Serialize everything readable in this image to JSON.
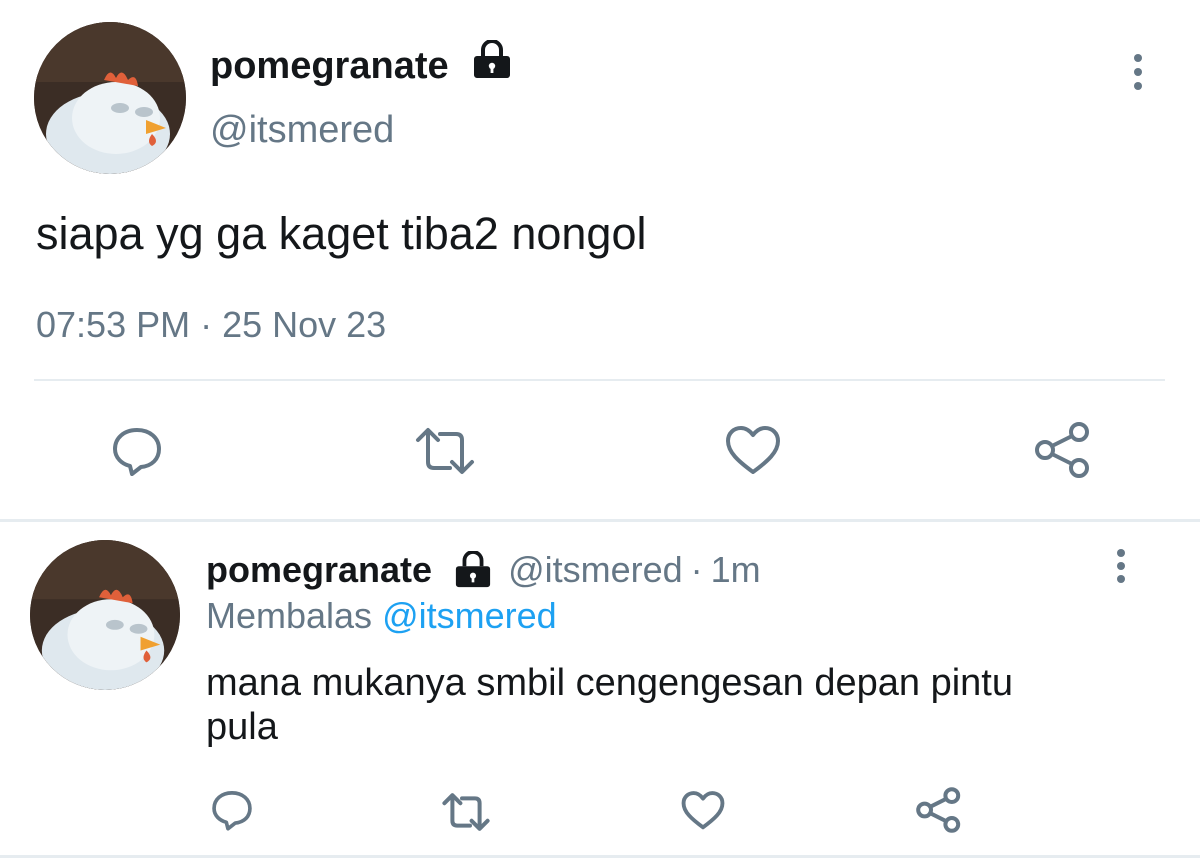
{
  "main_tweet": {
    "display_name": "pomegranate",
    "handle": "@itsmered",
    "text": "siapa yg ga kaget tiba2 nongol",
    "timestamp": "07:53 PM · 25 Nov 23",
    "actions": [
      "reply-icon",
      "retweet-icon",
      "like-icon",
      "share-icon"
    ]
  },
  "reply_tweet": {
    "display_name": "pomegranate",
    "handle": "@itsmered",
    "separator": "·",
    "age": "1m",
    "replying_prefix": "Membalas",
    "replying_to": "@itsmered",
    "text_line1": "mana mukanya smbil cengengesan depan pintu",
    "text_line2": "pula",
    "actions": [
      "reply-icon",
      "retweet-icon",
      "like-icon",
      "share-icon"
    ]
  },
  "colors": {
    "text": "#14171a",
    "muted": "#657786",
    "link": "#1da1f2",
    "divider": "#e6ecf0"
  },
  "icons": {
    "lock": "lock-icon",
    "more": "more-vertical-icon"
  }
}
